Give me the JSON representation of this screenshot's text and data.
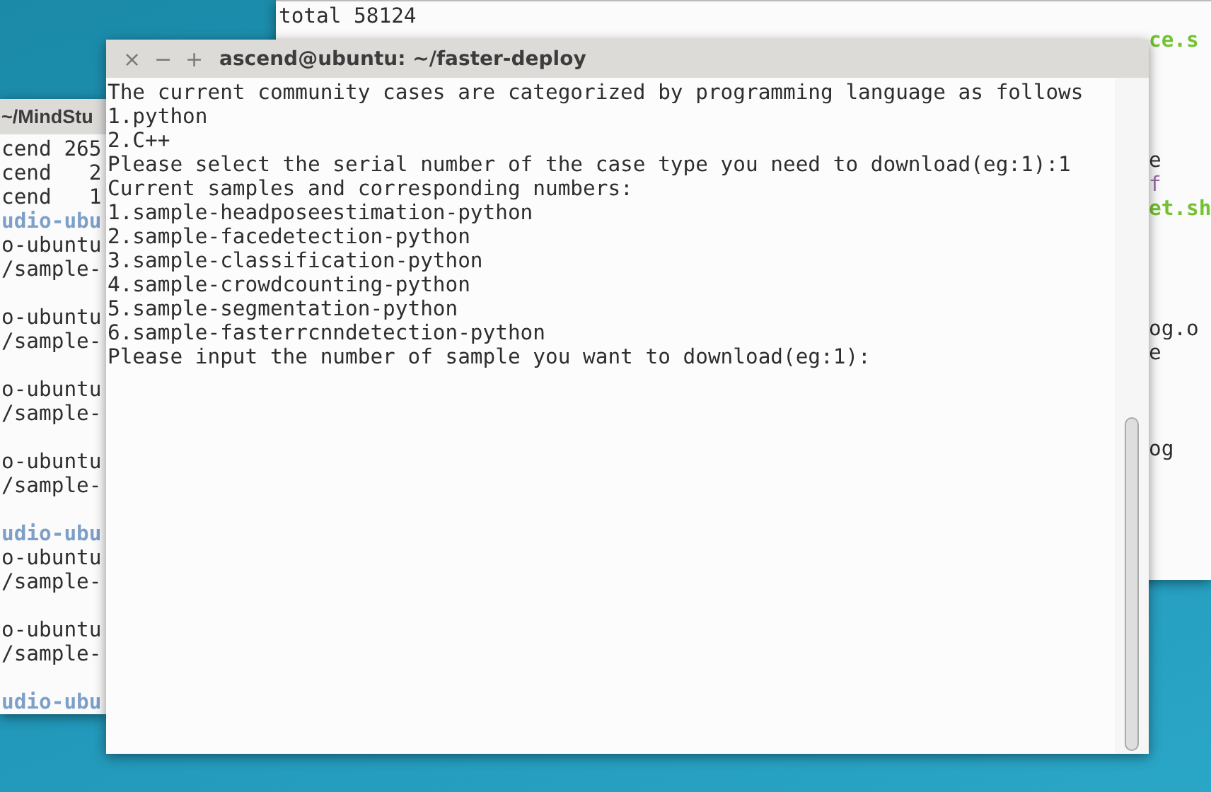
{
  "left_window": {
    "title": "~/MindStu",
    "lines": [
      {
        "text": "cend 265",
        "kind": "plain"
      },
      {
        "text": "cend   2",
        "kind": "plain"
      },
      {
        "text": "cend   1",
        "kind": "plain"
      },
      {
        "text": "udio-ubu",
        "kind": "prompt"
      },
      {
        "text": "o-ubuntu",
        "kind": "plain"
      },
      {
        "text": "/sample-",
        "kind": "plain"
      },
      {
        "text": "o-ubuntu",
        "kind": "plain"
      },
      {
        "text": "/sample-",
        "kind": "plain"
      },
      {
        "text": "o-ubuntu",
        "kind": "plain"
      },
      {
        "text": "/sample-",
        "kind": "plain"
      },
      {
        "text": "o-ubuntu",
        "kind": "plain"
      },
      {
        "text": "/sample-",
        "kind": "plain"
      },
      {
        "text": "udio-ubu",
        "kind": "prompt"
      },
      {
        "text": "o-ubuntu",
        "kind": "plain"
      },
      {
        "text": "/sample-",
        "kind": "plain"
      },
      {
        "text": "o-ubuntu",
        "kind": "plain"
      },
      {
        "text": "/sample-",
        "kind": "plain"
      },
      {
        "text": "udio-ubu",
        "kind": "prompt"
      }
    ]
  },
  "right_window": {
    "lines": [
      {
        "segments": [
          {
            "text": "total 58124",
            "kind": "plain"
          }
        ]
      },
      {
        "segments": [
          {
            "text": "ce.s",
            "kind": "exec"
          }
        ]
      },
      {
        "segments": [
          {
            "text": "e",
            "kind": "plain"
          }
        ]
      },
      {
        "segments": [
          {
            "text": "f",
            "kind": "link"
          }
        ]
      },
      {
        "segments": [
          {
            "text": "et.sh",
            "kind": "exec"
          }
        ]
      },
      {
        "segments": [
          {
            "text": "og.o",
            "kind": "plain"
          }
        ]
      },
      {
        "segments": [
          {
            "text": "e",
            "kind": "plain"
          }
        ]
      },
      {
        "segments": [
          {
            "text": "og",
            "kind": "plain"
          }
        ]
      }
    ]
  },
  "front_window": {
    "title": "ascend@ubuntu: ~/faster-deploy",
    "buttons": [
      "×",
      "−",
      "+"
    ],
    "lines": [
      "The current community cases are categorized by programming language as follows",
      "1.python",
      "2.C++",
      "Please select the serial number of the case type you need to download(eg:1):1",
      "Current samples and corresponding numbers:",
      "1.sample-headposeestimation-python",
      "2.sample-facedetection-python",
      "3.sample-classification-python",
      "4.sample-crowdcounting-python",
      "5.sample-segmentation-python",
      "6.sample-fasterrcnndetection-python",
      "Please input the number of sample you want to download(eg:1):"
    ]
  }
}
